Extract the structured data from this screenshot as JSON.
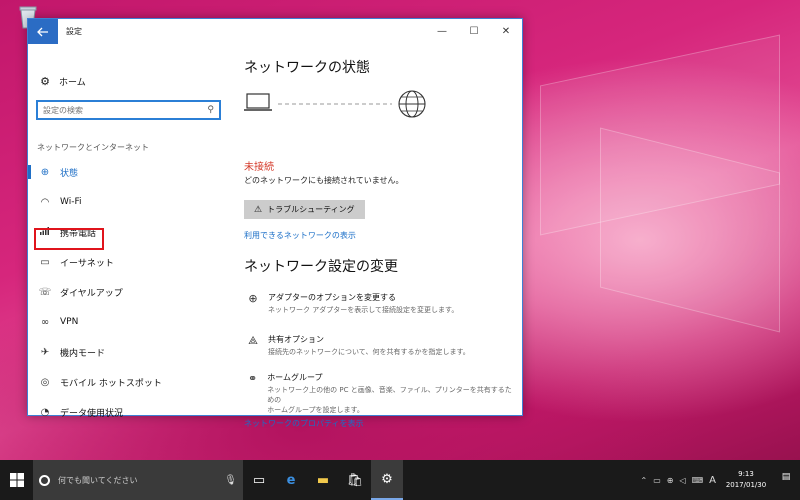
{
  "window": {
    "title": "設定"
  },
  "sidebar": {
    "home_label": "ホーム",
    "search_placeholder": "設定の検索",
    "section_label": "ネットワークとインターネット",
    "items": [
      {
        "label": "状態",
        "icon": "globe-status-icon"
      },
      {
        "label": "Wi-Fi",
        "icon": "wifi-icon"
      },
      {
        "label": "携帯電話",
        "icon": "cellular-icon"
      },
      {
        "label": "イーサネット",
        "icon": "ethernet-icon"
      },
      {
        "label": "ダイヤルアップ",
        "icon": "dialup-icon"
      },
      {
        "label": "VPN",
        "icon": "vpn-icon"
      },
      {
        "label": "機内モード",
        "icon": "airplane-icon"
      },
      {
        "label": "モバイル ホットスポット",
        "icon": "hotspot-icon"
      },
      {
        "label": "データ使用状況",
        "icon": "data-usage-icon"
      }
    ]
  },
  "main": {
    "network_status_title": "ネットワークの状態",
    "status": "未接続",
    "status_desc": "どのネットワークにも接続されていません。",
    "troubleshoot_label": "トラブルシューティング",
    "available_networks_link": "利用できるネットワークの表示",
    "change_settings_title": "ネットワーク設定の変更",
    "options": [
      {
        "title": "アダプターのオプションを変更する",
        "desc": "ネットワーク アダプターを表示して接続設定を変更します。"
      },
      {
        "title": "共有オプション",
        "desc": "接続先のネットワークについて、何を共有するかを指定します。"
      },
      {
        "title": "ホームグループ",
        "desc1": "ネットワーク上の他の PC と画像、音楽、ファイル、プリンターを共有するための",
        "desc2": "ホームグループを設定します。"
      }
    ],
    "properties_link": "ネットワークのプロパティを表示"
  },
  "taskbar": {
    "search_placeholder": "何でも聞いてください",
    "time": "9:13",
    "date": "2017/01/30",
    "ime": "A"
  },
  "colors": {
    "accent": "#1f6fc6",
    "status_red": "#d43a2a",
    "highlight_red": "#e0141c"
  }
}
